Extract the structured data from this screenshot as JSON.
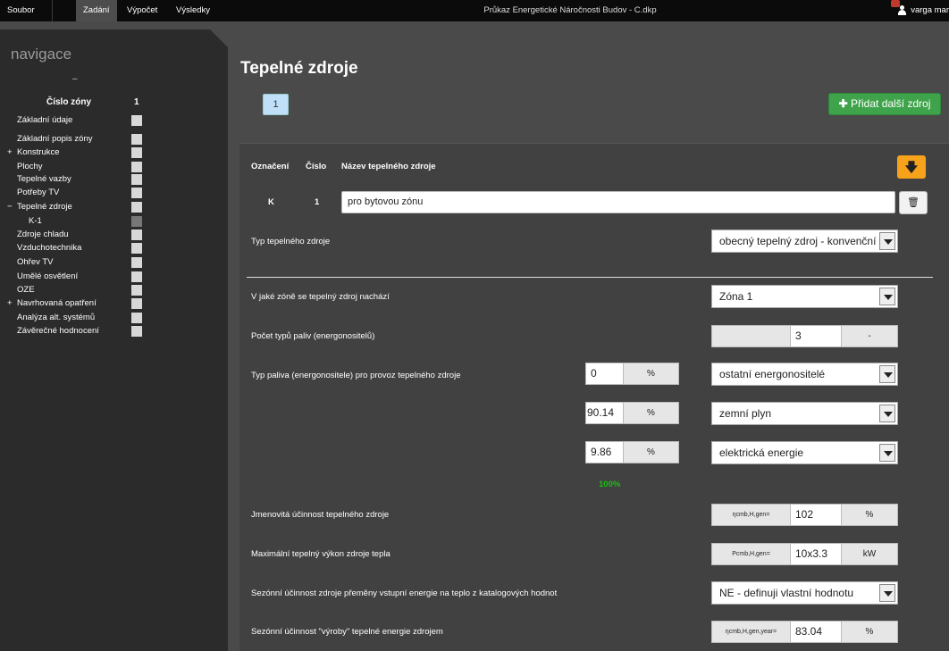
{
  "topbar": {
    "menu": [
      "Soubor",
      "Zadání",
      "Výpočet",
      "Výsledky"
    ],
    "title": "Průkaz Energetické Náročnosti Budov - C.dkp",
    "user": "varga mar"
  },
  "sidebar": {
    "title": "navigace",
    "collapse": "–",
    "zone_label": "Číslo zóny",
    "zone_number": "1",
    "items": [
      {
        "label": "Základní údaje",
        "prefix": ""
      },
      {
        "label": "Základní popis zóny",
        "prefix": ""
      },
      {
        "label": "Konstrukce",
        "prefix": "+"
      },
      {
        "label": "Plochy",
        "prefix": ""
      },
      {
        "label": "Tepelné vazby",
        "prefix": ""
      },
      {
        "label": "Potřeby TV",
        "prefix": ""
      },
      {
        "label": "Tepelné zdroje",
        "prefix": "−"
      },
      {
        "label": "K-1",
        "prefix": ""
      },
      {
        "label": "Zdroje chladu",
        "prefix": ""
      },
      {
        "label": "Vzduchotechnika",
        "prefix": ""
      },
      {
        "label": "Ohřev TV",
        "prefix": ""
      },
      {
        "label": "Umělé osvětlení",
        "prefix": ""
      },
      {
        "label": "OZE",
        "prefix": ""
      },
      {
        "label": "Navrhovaná opatření",
        "prefix": "+"
      },
      {
        "label": "Analýza alt. systémů",
        "prefix": ""
      },
      {
        "label": "Závěrečné hodnocení",
        "prefix": ""
      }
    ]
  },
  "main": {
    "title": "Tepelné zdroje",
    "zone_tab": "1",
    "add_button": "Přidat další zdroj",
    "headers": {
      "oznaceni": "Označení",
      "cislo": "Číslo",
      "nazev": "Název tepelného zdroje"
    },
    "row": {
      "oznaceni": "K",
      "cislo": "1",
      "nazev": "pro  bytovou zónu"
    },
    "fields": {
      "typ_zdroje": {
        "label": "Typ tepelného zdroje",
        "value": "obecný tepelný zdroj - konvenční"
      },
      "zona": {
        "label": "V jaké zóně se tepelný zdroj nachází",
        "value": "Zóna 1"
      },
      "pocet_paliv": {
        "label": "Počet typů paliv (energonositelů)",
        "value": "3",
        "unit": "-"
      },
      "typ_paliva": {
        "label": "Typ paliva (energonositele) pro provoz tepelného zdroje",
        "unit": "%",
        "rows": [
          {
            "pct": "0",
            "fuel": "ostatní energonositelé"
          },
          {
            "pct": "90.14",
            "fuel": "zemní plyn"
          },
          {
            "pct": "9.86",
            "fuel": "elektrická energie"
          }
        ],
        "total": "100%"
      },
      "ucinnost": {
        "label": "Jmenovitá účinnost tepelného zdroje",
        "symbol": "ηcmb,H,gen=",
        "value": "102",
        "unit": "%"
      },
      "vykon": {
        "label": "Maximální tepelný výkon zdroje tepla",
        "symbol": "Pcmb,H,gen=",
        "value": "10x3.3",
        "unit": "kW"
      },
      "sezonni_katalog": {
        "label": "Sezónní účinnost zdroje přeměny vstupní energie na teplo z katalogových hodnot",
        "value": "NE - definuji vlastní hodnotu"
      },
      "sezonni_vyroba": {
        "label": "Sezónní účinnost \"výroby\" tepelné energie zdrojem",
        "symbol": "ηcmb,H,gen,year=",
        "value": "83.04",
        "unit": "%"
      }
    }
  }
}
